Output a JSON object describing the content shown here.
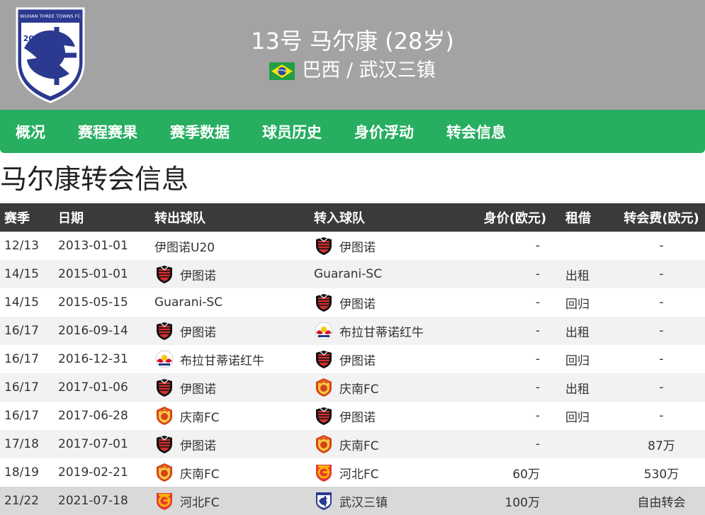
{
  "header": {
    "club_logo_text": "WUHAN THREE TOWNS FC",
    "club_logo_year": "2013",
    "player_title": "13号 马尔康 (28岁)",
    "player_sub": "巴西 / 武汉三镇",
    "flag_icon": "brazil-flag-icon"
  },
  "nav": {
    "items": [
      "概况",
      "赛程赛果",
      "赛季数据",
      "球员历史",
      "身价浮动",
      "转会信息"
    ]
  },
  "page_title": "马尔康转会信息",
  "table": {
    "headers": {
      "season": "赛季",
      "date": "日期",
      "from": "转出球队",
      "to": "转入球队",
      "value": "身价(欧元)",
      "loan": "租借",
      "fee": "转会费(欧元)"
    },
    "rows": [
      {
        "season": "12/13",
        "date": "2013-01-01",
        "from": "伊图诺U20",
        "from_badge": "",
        "to": "伊图诺",
        "to_badge": "ituano",
        "value": "-",
        "loan": "",
        "fee": "-"
      },
      {
        "season": "14/15",
        "date": "2015-01-01",
        "from": "伊图诺",
        "from_badge": "ituano",
        "to": "Guarani-SC",
        "to_badge": "",
        "value": "-",
        "loan": "出租",
        "fee": "-"
      },
      {
        "season": "14/15",
        "date": "2015-05-15",
        "from": "Guarani-SC",
        "from_badge": "",
        "to": "伊图诺",
        "to_badge": "ituano",
        "value": "-",
        "loan": "回归",
        "fee": "-"
      },
      {
        "season": "16/17",
        "date": "2016-09-14",
        "from": "伊图诺",
        "from_badge": "ituano",
        "to": "布拉甘蒂诺红牛",
        "to_badge": "redbull",
        "value": "-",
        "loan": "出租",
        "fee": "-"
      },
      {
        "season": "16/17",
        "date": "2016-12-31",
        "from": "布拉甘蒂诺红牛",
        "from_badge": "redbull",
        "to": "伊图诺",
        "to_badge": "ituano",
        "value": "-",
        "loan": "回归",
        "fee": "-"
      },
      {
        "season": "16/17",
        "date": "2017-01-06",
        "from": "伊图诺",
        "from_badge": "ituano",
        "to": "庆南FC",
        "to_badge": "gyeongnam",
        "value": "-",
        "loan": "出租",
        "fee": "-"
      },
      {
        "season": "16/17",
        "date": "2017-06-28",
        "from": "庆南FC",
        "from_badge": "gyeongnam",
        "to": "伊图诺",
        "to_badge": "ituano",
        "value": "-",
        "loan": "回归",
        "fee": "-"
      },
      {
        "season": "17/18",
        "date": "2017-07-01",
        "from": "伊图诺",
        "from_badge": "ituano",
        "to": "庆南FC",
        "to_badge": "gyeongnam",
        "value": "-",
        "loan": "",
        "fee": "87万"
      },
      {
        "season": "18/19",
        "date": "2019-02-21",
        "from": "庆南FC",
        "from_badge": "gyeongnam",
        "to": "河北FC",
        "to_badge": "hebei",
        "value": "60万",
        "loan": "",
        "fee": "530万"
      },
      {
        "season": "21/22",
        "date": "2021-07-18",
        "from": "河北FC",
        "from_badge": "hebei",
        "to": "武汉三镇",
        "to_badge": "wuhan",
        "value": "100万",
        "loan": "",
        "fee": "自由转会"
      }
    ]
  },
  "colors": {
    "header_bg": "#a3a3a3",
    "nav_bg": "#27ae60",
    "table_header_bg": "#3a3a3a",
    "logo_blue": "#2b3990"
  }
}
